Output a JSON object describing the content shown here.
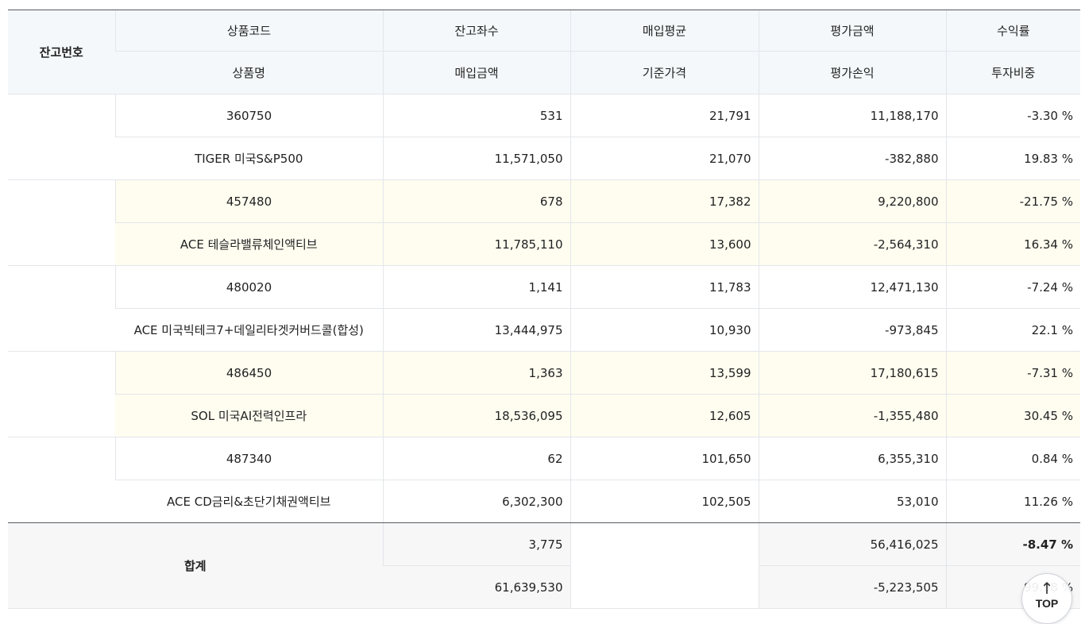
{
  "header": {
    "account_no": "잔고번호",
    "row1": [
      "상품코드",
      "잔고좌수",
      "매입평균",
      "평가금액",
      "수익률"
    ],
    "row2": [
      "상품명",
      "매입금액",
      "기준가격",
      "평가손익",
      "투자비중"
    ]
  },
  "rows": [
    {
      "code": "360750",
      "qty": "531",
      "avg": "21,791",
      "eval": "11,188,170",
      "ret": "-3.30 %",
      "name": "TIGER 미국S&P500",
      "buy": "11,571,050",
      "base": "21,070",
      "pnl": "-382,880",
      "weight": "19.83 %"
    },
    {
      "code": "457480",
      "qty": "678",
      "avg": "17,382",
      "eval": "9,220,800",
      "ret": "-21.75 %",
      "name": "ACE 테슬라밸류체인액티브",
      "buy": "11,785,110",
      "base": "13,600",
      "pnl": "-2,564,310",
      "weight": "16.34 %"
    },
    {
      "code": "480020",
      "qty": "1,141",
      "avg": "11,783",
      "eval": "12,471,130",
      "ret": "-7.24 %",
      "name": "ACE 미국빅테크7+데일리타겟커버드콜(합성)",
      "buy": "13,444,975",
      "base": "10,930",
      "pnl": "-973,845",
      "weight": "22.1 %"
    },
    {
      "code": "486450",
      "qty": "1,363",
      "avg": "13,599",
      "eval": "17,180,615",
      "ret": "-7.31 %",
      "name": "SOL 미국AI전력인프라",
      "buy": "18,536,095",
      "base": "12,605",
      "pnl": "-1,355,480",
      "weight": "30.45 %"
    },
    {
      "code": "487340",
      "qty": "62",
      "avg": "101,650",
      "eval": "6,355,310",
      "ret": "0.84 %",
      "name": "ACE CD금리&초단기채권액티브",
      "buy": "6,302,300",
      "base": "102,505",
      "pnl": "53,010",
      "weight": "11.26 %"
    }
  ],
  "total": {
    "label": "합계",
    "qty": "3,775",
    "eval": "56,416,025",
    "ret": "-8.47 %",
    "buy": "61,639,530",
    "pnl": "-5,223,505",
    "weight": "99.98 %"
  },
  "top_button": {
    "label": "TOP",
    "icon": "arrow-up-icon"
  },
  "colors": {
    "header_bg": "#f4f8fb",
    "alt_row_bg": "#fffdf0",
    "total_bg": "#f7f7f7"
  }
}
